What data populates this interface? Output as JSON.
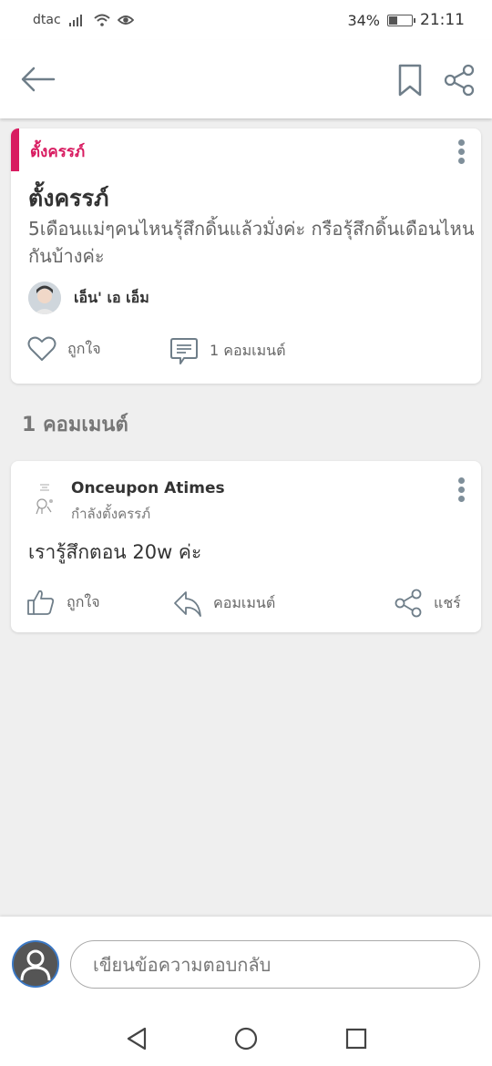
{
  "status_bar": {
    "carrier": "dtac",
    "battery_percent": "34%",
    "time": "21:11"
  },
  "header": {
    "back_icon": "arrow-left-icon",
    "bookmark_icon": "bookmark-icon",
    "share_icon": "share-icon"
  },
  "post": {
    "tag": "ตั้งครรภ์",
    "title": "ตั้งครรภ์",
    "body": "5เดือนแม่ๆคนไหนรุ้สึกดิ้นแล้วมั่งค่ะ กรือรุ้สึกดิ้นเดือนไหนกันบ้างค่ะ",
    "author": "เอ็น' เอ เอ็ม",
    "like_label": "ถูกใจ",
    "comment_count_label": "1 คอมเมนต์"
  },
  "comments_section": {
    "title": "1 คอมเมนต์"
  },
  "comment": {
    "author": "Onceupon Atimes",
    "role": "กำลังตั้งครรภ์",
    "text": "เรารู้สึกตอน 20w ค่ะ",
    "like_label": "ถูกใจ",
    "reply_label": "คอมเมนต์",
    "share_label": "แชร์"
  },
  "reply_box": {
    "placeholder": "เขียนข้อความตอบกลับ"
  },
  "colors": {
    "accent": "#d81b60",
    "avatar_border": "#3b78c4"
  }
}
